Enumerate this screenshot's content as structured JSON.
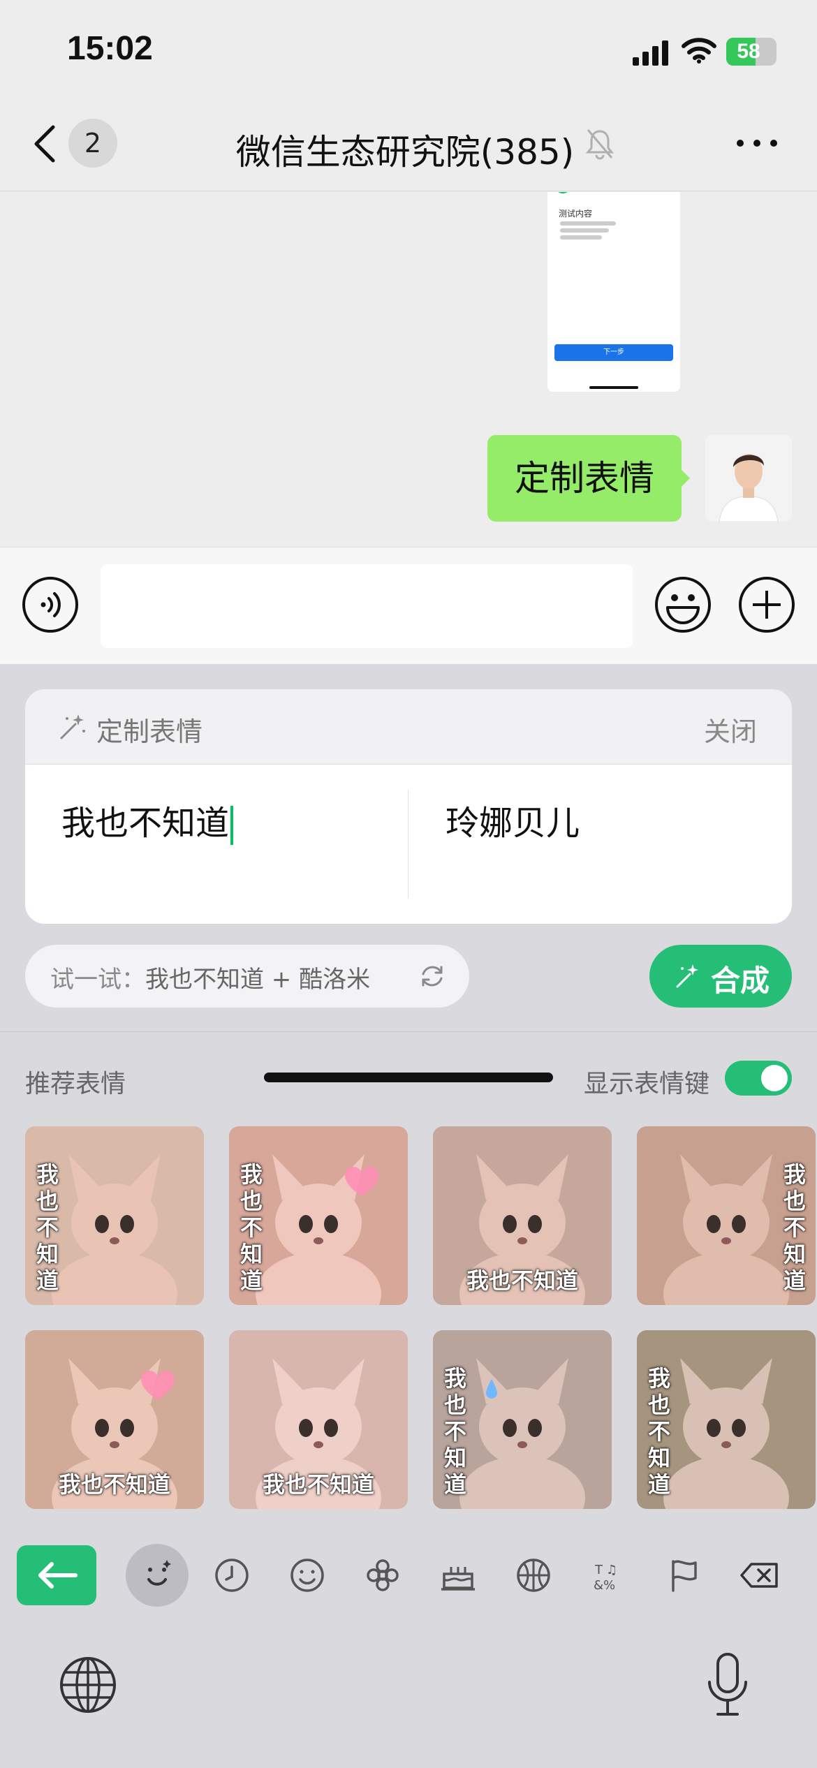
{
  "status_bar": {
    "time": "15:02",
    "battery_percent": 58,
    "battery_label": "58",
    "battery_color": "#34c759",
    "icons": [
      "cellular-signal-icon",
      "wifi-icon",
      "battery-charging-icon"
    ]
  },
  "nav": {
    "back_icon": "chevron-left-icon",
    "unread_count": "2",
    "title": "微信生态研究院(385)",
    "mute_icon": "bell-slash-icon",
    "more_icon": "more-horizontal-icon"
  },
  "chat": {
    "shared_image_texts": {
      "section": "测试内容",
      "button": "下一步"
    },
    "message": "定制表情"
  },
  "input_bar": {
    "placeholder": "",
    "voice_icon": "voice-icon",
    "emoji_icon": "emoji-face-icon",
    "plus_icon": "plus-circle-icon"
  },
  "custom_sticker": {
    "title": "定制表情",
    "close": "关闭",
    "text_field": "我也不知道",
    "character_field": "玲娜贝儿",
    "try_label": "试一试：",
    "try_value": "我也不知道 + 酷洛米",
    "compose_button": "合成",
    "accent": "#25be77"
  },
  "recommended": {
    "title": "推荐表情",
    "toggle_label": "显示表情键",
    "toggle_on": true,
    "stickers": [
      {
        "caption": "我也不知道",
        "style": "vertical-left"
      },
      {
        "caption": "我也不知道",
        "style": "vertical-left",
        "extra": "heart"
      },
      {
        "caption": "我也不知道",
        "style": "bottom"
      },
      {
        "caption": "我也不知道",
        "style": "vertical-right"
      },
      {
        "caption": "我也不知道",
        "style": "bottom",
        "extra": "heart"
      },
      {
        "caption": "我也不知道",
        "style": "bottom"
      },
      {
        "caption": "我也不知道",
        "style": "vertical-left",
        "extra": "sweat"
      },
      {
        "caption": "我也不知道",
        "style": "vertical-left"
      }
    ]
  },
  "emoji_toolbar": {
    "icons": [
      "back-arrow-icon",
      "custom-face-icon",
      "recent-clock-icon",
      "smiley-icon",
      "flower-icon",
      "cake-icon",
      "ball-icon",
      "symbols-icon",
      "flag-icon",
      "delete-icon"
    ]
  },
  "keyboard_bottom": {
    "left_icon": "globe-icon",
    "right_icon": "microphone-icon"
  }
}
